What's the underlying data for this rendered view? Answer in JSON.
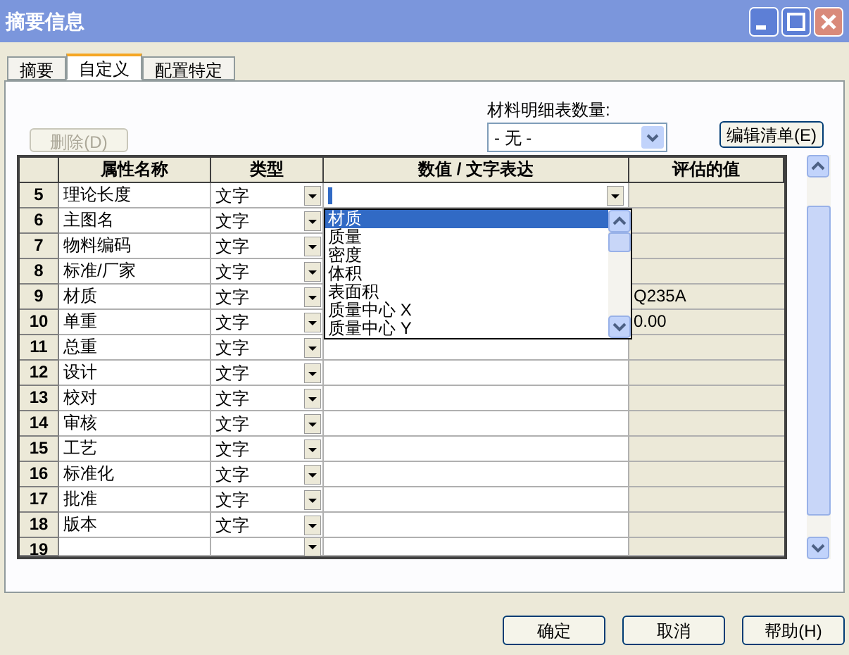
{
  "window": {
    "title": "摘要信息"
  },
  "tabs": [
    {
      "label": "摘要",
      "selected": false
    },
    {
      "label": "自定义",
      "selected": true
    },
    {
      "label": "配置特定",
      "selected": false
    }
  ],
  "delete_button": {
    "label": "删除(D)",
    "disabled": true
  },
  "bom_quantity": {
    "label": "材料明细表数量:",
    "value": "- 无 -"
  },
  "edit_list_button": {
    "label": "编辑清单(E)",
    "disabled": false
  },
  "table": {
    "columns": [
      "属性名称",
      "类型",
      "数值 / 文字表达",
      "评估的值"
    ],
    "rows": [
      {
        "num": "5",
        "name": "理论长度",
        "type": "文字",
        "value_dropdown": {
          "items": [
            {
              "label": "材质",
              "selected": true
            },
            {
              "label": "质量",
              "selected": false
            },
            {
              "label": "密度",
              "selected": false
            },
            {
              "label": "体积",
              "selected": false
            },
            {
              "label": "表面积",
              "selected": false
            },
            {
              "label": "质量中心 X",
              "selected": false
            },
            {
              "label": "质量中心 Y",
              "selected": false
            }
          ]
        }
      },
      {
        "num": "6",
        "name": "主图名",
        "type": "文字"
      },
      {
        "num": "7",
        "name": "物料编码",
        "type": "文字"
      },
      {
        "num": "8",
        "name": "标准/厂家",
        "type": "文字"
      },
      {
        "num": "9",
        "name": "材质",
        "type": "文字",
        "evaluated": "Q235A"
      },
      {
        "num": "10",
        "name": "单重",
        "type": "文字",
        "evaluated": "0.00"
      },
      {
        "num": "11",
        "name": "总重",
        "type": "文字"
      },
      {
        "num": "12",
        "name": "设计",
        "type": "文字"
      },
      {
        "num": "13",
        "name": "校对",
        "type": "文字"
      },
      {
        "num": "14",
        "name": "审核",
        "type": "文字"
      },
      {
        "num": "15",
        "name": "工艺",
        "type": "文字"
      },
      {
        "num": "16",
        "name": "标准化",
        "type": "文字"
      },
      {
        "num": "17",
        "name": "批准",
        "type": "文字"
      },
      {
        "num": "18",
        "name": "版本",
        "type": "文字"
      },
      {
        "num": "19"
      }
    ]
  },
  "buttons": [
    "确定",
    "取消",
    "帮助(H)"
  ]
}
